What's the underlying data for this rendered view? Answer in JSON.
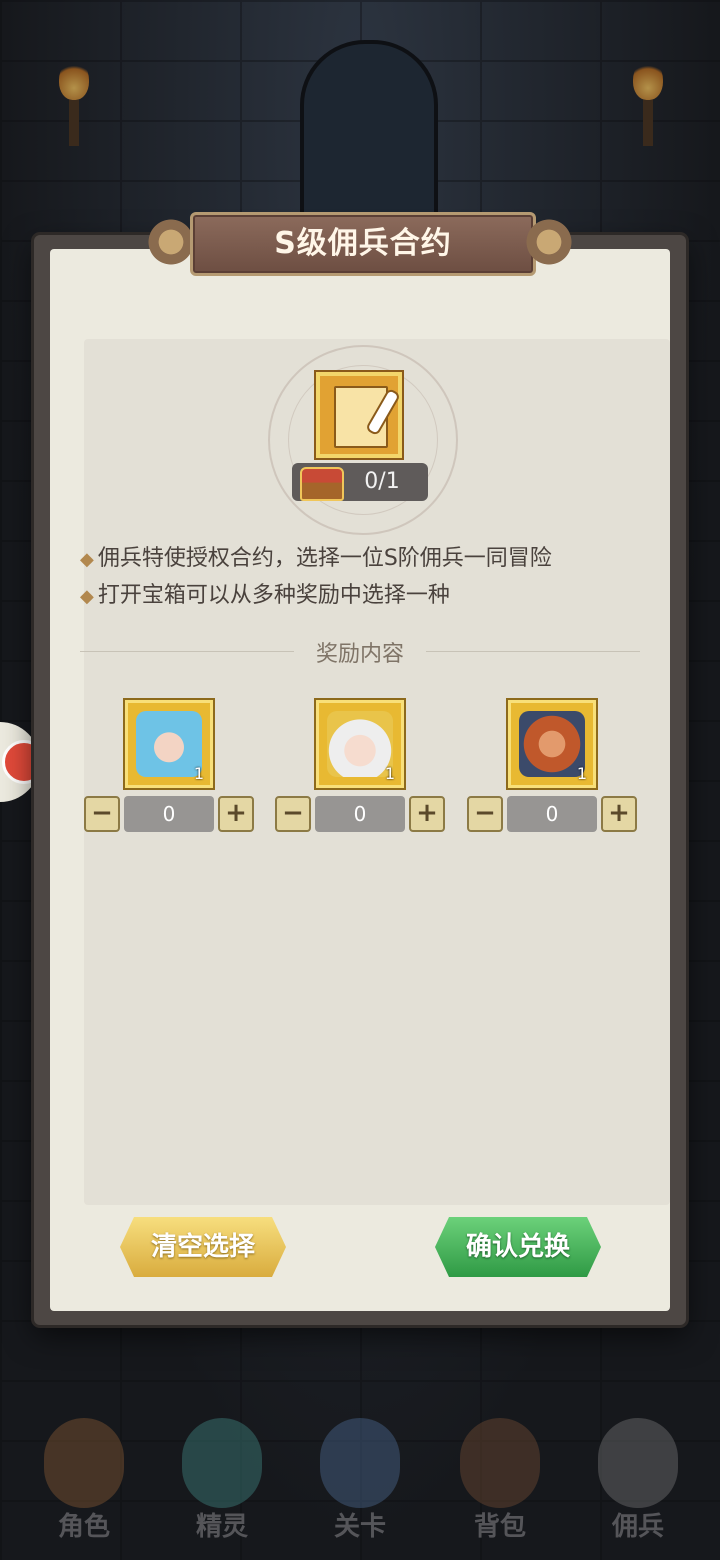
{
  "dialog": {
    "title": "S级佣兵合约",
    "count": "0/1",
    "descriptions": [
      "佣兵特使授权合约，选择一位S阶佣兵一同冒险",
      "打开宝箱可以从多种奖励中选择一种"
    ],
    "section_title": "奖励内容",
    "rewards": [
      {
        "icon": "hero-blue-hair-icon",
        "quantity": "1",
        "selected": "0",
        "minus": "−",
        "plus": "+"
      },
      {
        "icon": "hero-white-hair-icon",
        "quantity": "1",
        "selected": "0",
        "minus": "−",
        "plus": "+"
      },
      {
        "icon": "hero-bearded-warrior-icon",
        "quantity": "1",
        "selected": "0",
        "minus": "−",
        "plus": "+"
      }
    ],
    "buttons": {
      "clear": "清空选择",
      "confirm": "确认兑换"
    }
  },
  "nav": {
    "items": [
      {
        "label": "角色",
        "icon": "character-icon"
      },
      {
        "label": "精灵",
        "icon": "spirit-icon"
      },
      {
        "label": "关卡",
        "icon": "stage-icon"
      },
      {
        "label": "背包",
        "icon": "backpack-icon"
      },
      {
        "label": "佣兵",
        "icon": "mercenary-icon"
      }
    ]
  },
  "colors": {
    "accent_gold": "#e8b932",
    "confirm_green": "#3fae54",
    "clear_yellow": "#e8c35a",
    "title_brown": "#7b5b4d"
  }
}
